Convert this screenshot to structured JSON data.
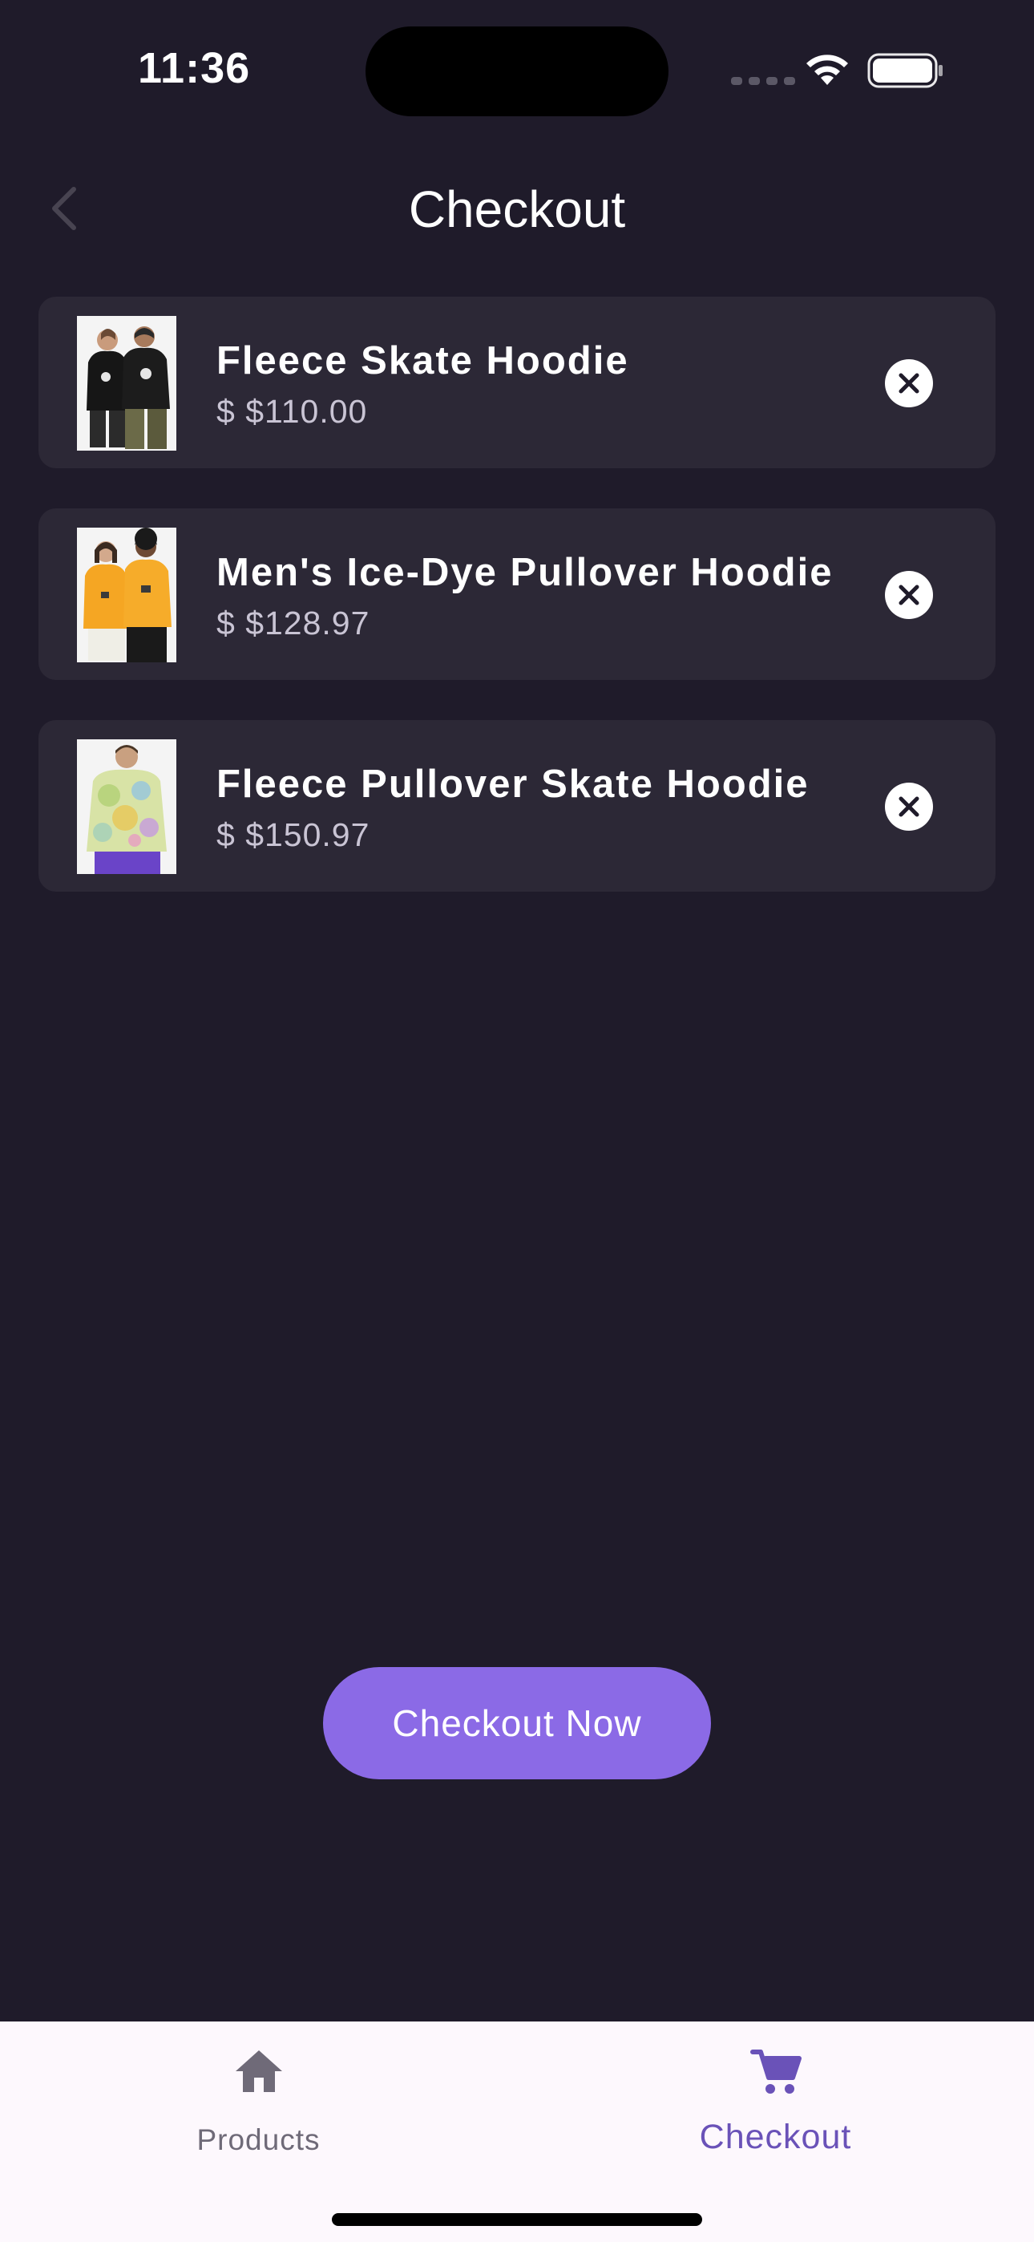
{
  "status_bar": {
    "time": "11:36"
  },
  "header": {
    "title": "Checkout"
  },
  "cart": {
    "items": [
      {
        "name": "Fleece Skate Hoodie",
        "price": "$ $110.00"
      },
      {
        "name": "Men's Ice-Dye Pullover Hoodie",
        "price": "$ $128.97"
      },
      {
        "name": "Fleece Pullover Skate Hoodie",
        "price": "$ $150.97"
      }
    ]
  },
  "checkout_button": {
    "label": "Checkout Now"
  },
  "bottom_nav": {
    "items": [
      {
        "label": "Products",
        "icon": "home-icon",
        "active": false
      },
      {
        "label": "Checkout",
        "icon": "cart-icon",
        "active": true
      }
    ]
  },
  "colors": {
    "background": "#1f1b2a",
    "card": "#2c2836",
    "accent": "#8b6ae6",
    "nav_active": "#6a52b8",
    "nav_inactive": "#6f6a78"
  },
  "icons": {
    "status": [
      "wifi-icon",
      "battery-icon",
      "signal-icon"
    ],
    "header": "back-icon",
    "remove": "close-circle-icon"
  }
}
